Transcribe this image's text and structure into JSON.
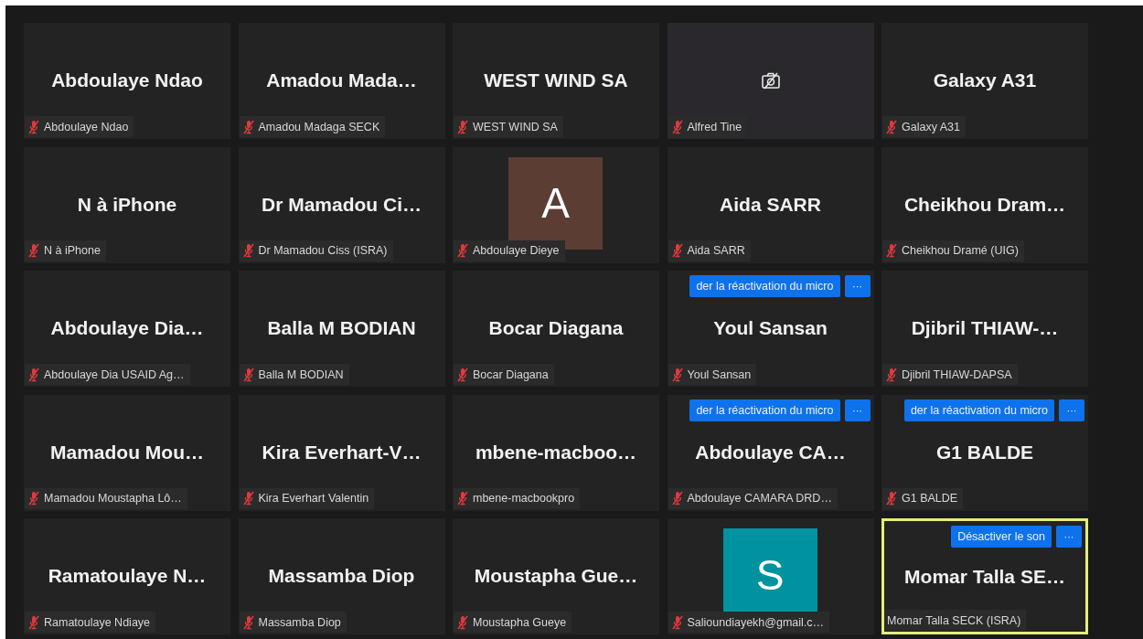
{
  "tiles": [
    {
      "kind": "name",
      "name": "Abdoulaye Ndao",
      "label": "Abdoulaye Ndao",
      "muted": true,
      "speaking": false
    },
    {
      "kind": "name",
      "name": "Amadou Mada…",
      "label": "Amadou Madaga SECK",
      "muted": true,
      "speaking": false
    },
    {
      "kind": "name",
      "name": "WEST WIND SA",
      "label": "WEST WIND SA",
      "muted": true,
      "speaking": false
    },
    {
      "kind": "camera_off",
      "label": "Alfred Tine",
      "muted": true,
      "speaking": false
    },
    {
      "kind": "name",
      "name": "Galaxy A31",
      "label": "Galaxy A31",
      "muted": true,
      "speaking": false
    },
    {
      "kind": "name",
      "name": "N à iPhone",
      "label": "N à iPhone",
      "muted": true,
      "speaking": false
    },
    {
      "kind": "name",
      "name": "Dr Mamadou Ci…",
      "label": "Dr Mamadou Ciss (ISRA)",
      "muted": true,
      "speaking": false
    },
    {
      "kind": "avatar",
      "letter": "A",
      "color": "#5b3d34",
      "label": "Abdoulaye Dieye",
      "muted": true,
      "speaking": false
    },
    {
      "kind": "name",
      "name": "Aida SARR",
      "label": "Aida SARR",
      "muted": true,
      "speaking": false
    },
    {
      "kind": "name",
      "name": "Cheikhou Dram…",
      "label": "Cheikhou Dramé (UIG)",
      "muted": true,
      "speaking": false
    },
    {
      "kind": "name",
      "name": "Abdoulaye Dia…",
      "label": "Abdoulaye Dia USAID Ag…",
      "muted": true,
      "speaking": false
    },
    {
      "kind": "name",
      "name": "Balla M BODIAN",
      "label": "Balla M BODIAN",
      "muted": true,
      "speaking": false
    },
    {
      "kind": "name",
      "name": "Bocar Diagana",
      "label": "Bocar Diagana",
      "muted": true,
      "speaking": false
    },
    {
      "kind": "name",
      "name": "Youl Sansan",
      "label": "Youl Sansan",
      "muted": true,
      "speaking": false,
      "action": "der la réactivation du micro",
      "more": "···"
    },
    {
      "kind": "name",
      "name": "Djibril THIAW-…",
      "label": "Djibril THIAW-DAPSA",
      "muted": true,
      "speaking": false
    },
    {
      "kind": "name",
      "name": "Mamadou Mou…",
      "label": "Mamadou Moustapha Lô…",
      "muted": true,
      "speaking": false
    },
    {
      "kind": "name",
      "name": "Kira Everhart-V…",
      "label": "Kira Everhart Valentin",
      "muted": true,
      "speaking": false
    },
    {
      "kind": "name",
      "name": "mbene-macboo…",
      "label": "mbene-macbookpro",
      "muted": true,
      "speaking": false
    },
    {
      "kind": "name",
      "name": "Abdoulaye CA…",
      "label": "Abdoulaye CAMARA DRD…",
      "muted": true,
      "speaking": false,
      "action": "der la réactivation du micro",
      "more": "···"
    },
    {
      "kind": "name",
      "name": "G1 BALDE",
      "label": "G1 BALDE",
      "muted": true,
      "speaking": false,
      "action": "der la réactivation du micro",
      "more": "···"
    },
    {
      "kind": "name",
      "name": "Ramatoulaye N…",
      "label": "Ramatoulaye Ndiaye",
      "muted": true,
      "speaking": false
    },
    {
      "kind": "name",
      "name": "Massamba Diop",
      "label": "Massamba Diop",
      "muted": true,
      "speaking": false
    },
    {
      "kind": "name",
      "name": "Moustapha Gue…",
      "label": "Moustapha Gueye",
      "muted": true,
      "speaking": false
    },
    {
      "kind": "avatar",
      "letter": "S",
      "color": "#00939f",
      "label": "Salioundiayekh@gmail.c…",
      "muted": true,
      "speaking": false
    },
    {
      "kind": "name",
      "name": "Momar Talla SE…",
      "label": "Momar Talla SECK (ISRA)",
      "muted": false,
      "speaking": true,
      "action": "Désactiver le son",
      "more": "···"
    }
  ]
}
